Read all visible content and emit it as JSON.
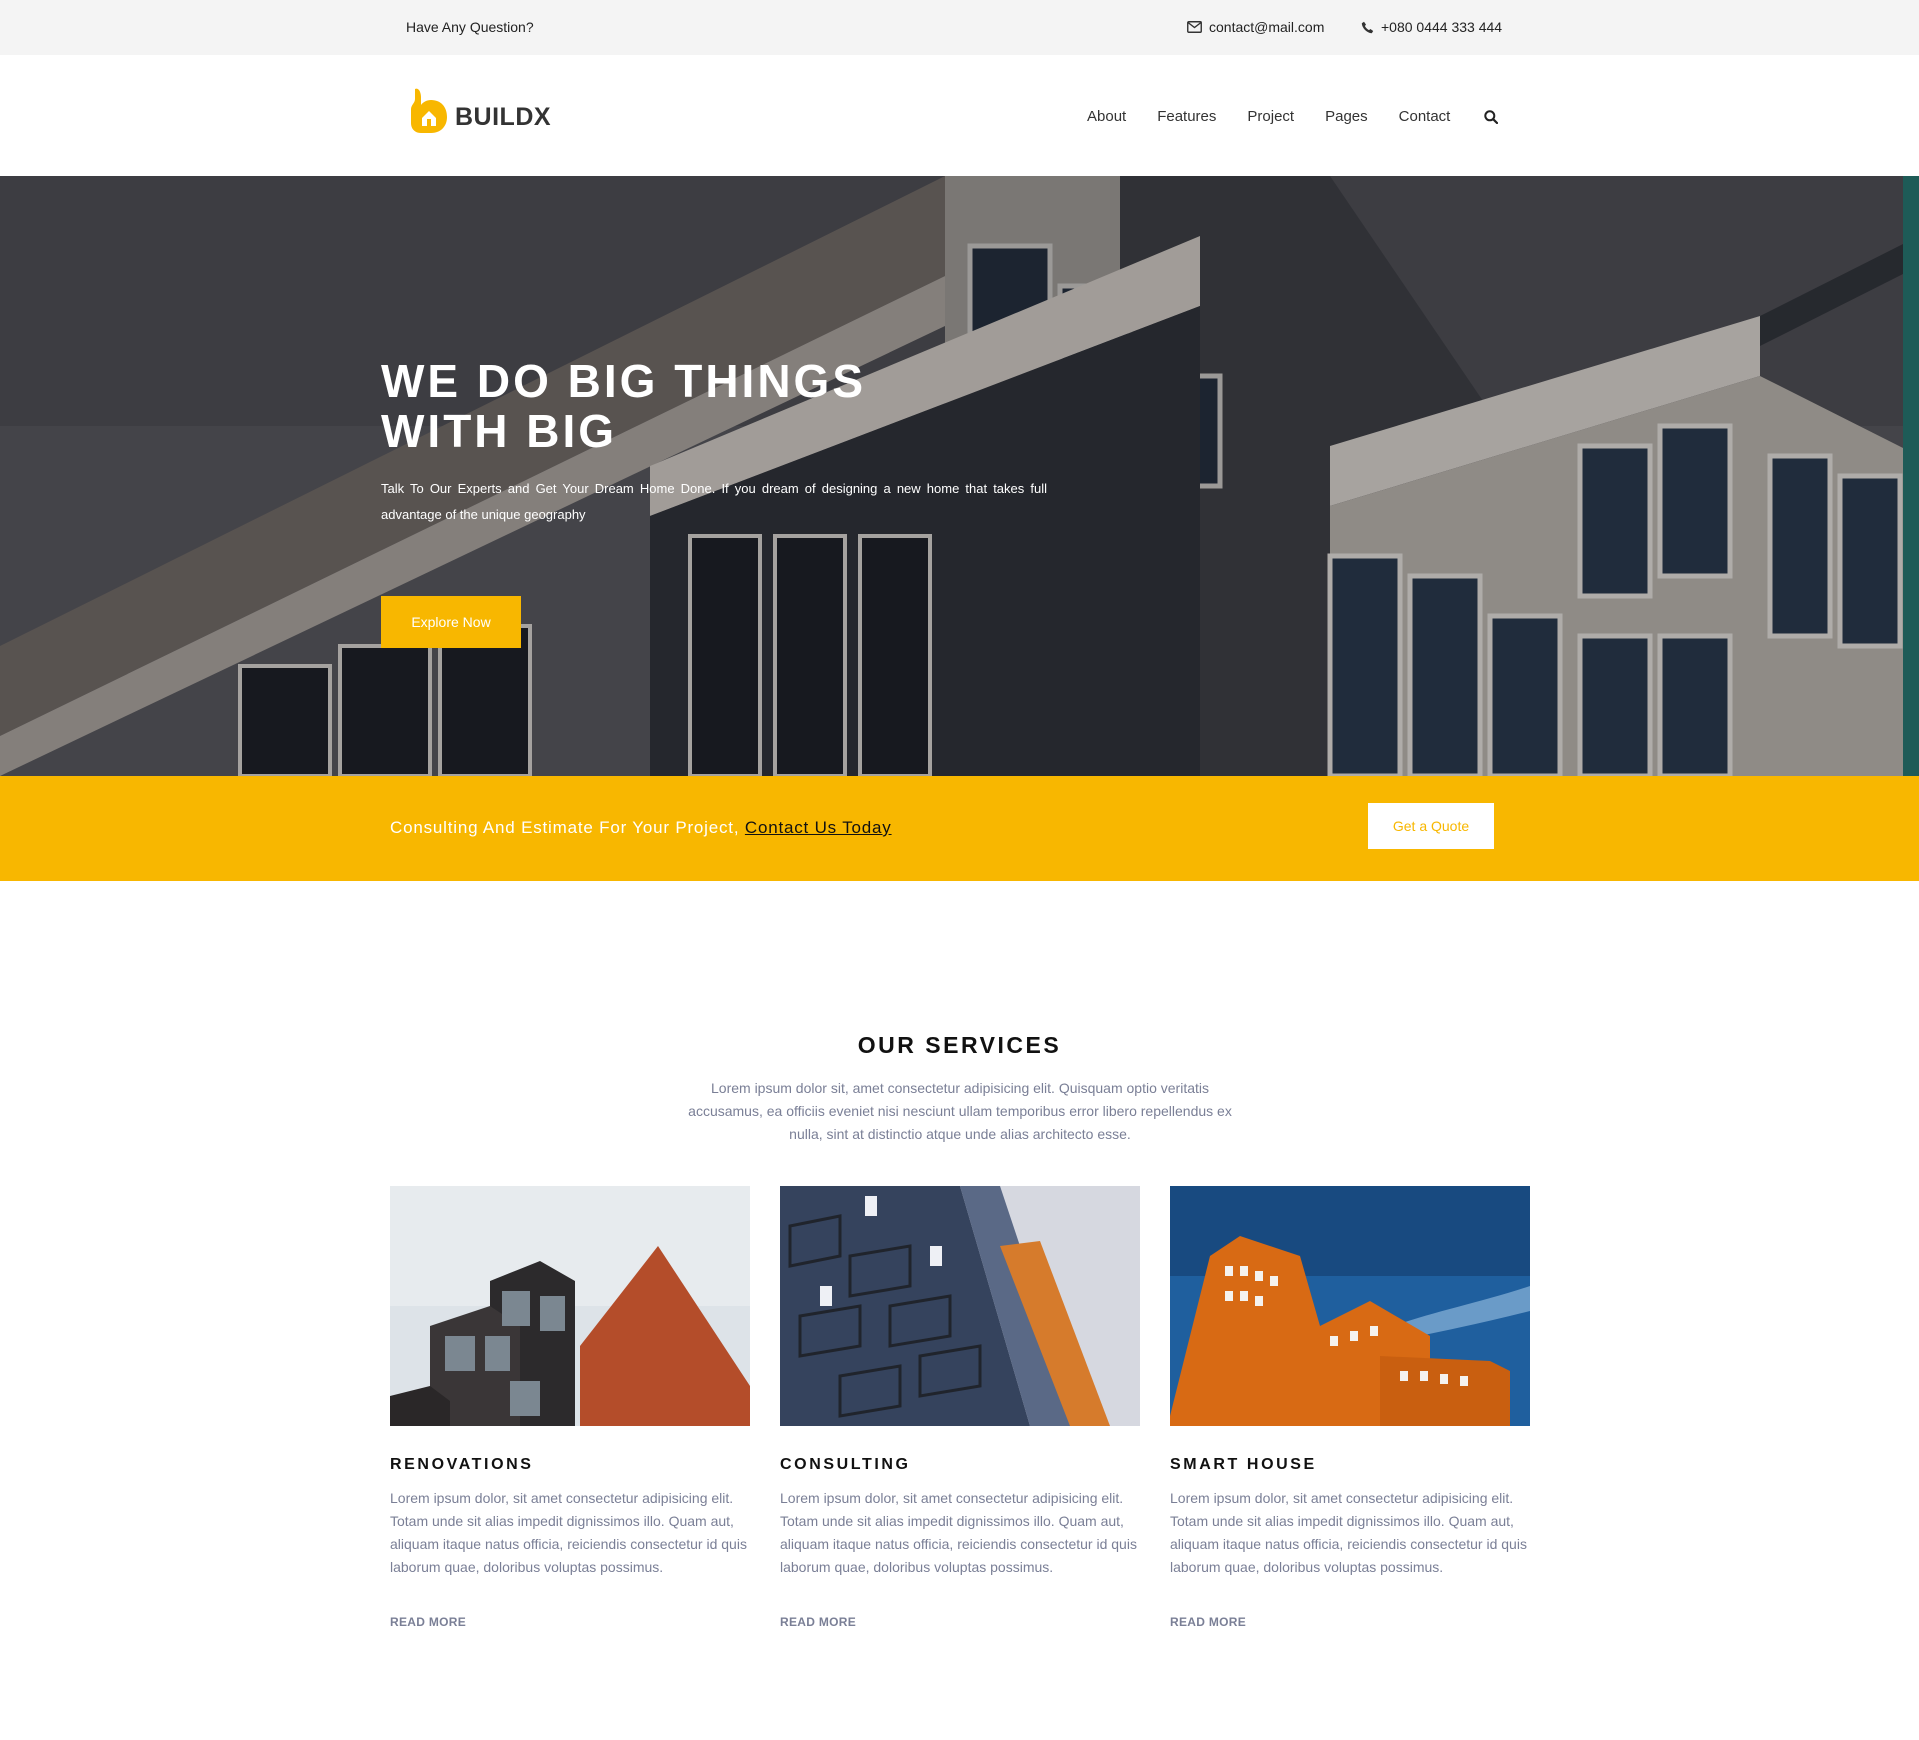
{
  "topbar": {
    "question": "Have Any Question?",
    "email": "contact@mail.com",
    "phone": "+080 0444 333 444",
    "email_icon": "envelope-icon",
    "phone_icon": "phone-icon"
  },
  "header": {
    "logo_text": "BUILDX",
    "nav": [
      "About",
      "Features",
      "Project",
      "Pages",
      "Contact"
    ],
    "search_icon": "search-icon"
  },
  "hero": {
    "title_line1": "WE DO BIG THINGS",
    "title_line2": "WITH BIG",
    "text": "Talk To Our Experts and Get Your Dream Home Done. If you dream of designing a new home that takes full advantage of the unique geography",
    "button": "Explore Now"
  },
  "cta": {
    "text": "Consulting And Estimate For Your Project,",
    "link": "Contact Us Today",
    "button": "Get a Quote"
  },
  "services": {
    "title": "OUR SERVICES",
    "description": "Lorem ipsum dolor sit, amet consectetur adipisicing elit. Quisquam optio veritatis accusamus, ea officiis eveniet nisi nesciunt ullam temporibus error libero repellendus ex nulla, sint at distinctio atque unde alias architecto esse.",
    "cards": [
      {
        "title": "RENOVATIONS",
        "body": "Lorem ipsum dolor, sit amet consectetur adipisicing elit. Totam unde sit alias impedit dignissimos illo. Quam aut, aliquam itaque natus officia, reiciendis consectetur id quis laborum quae, doloribus voluptas possimus.",
        "link": "READ MORE"
      },
      {
        "title": "CONSULTING",
        "body": "Lorem ipsum dolor, sit amet consectetur adipisicing elit. Totam unde sit alias impedit dignissimos illo. Quam aut, aliquam itaque natus officia, reiciendis consectetur id quis laborum quae, doloribus voluptas possimus.",
        "link": "READ MORE"
      },
      {
        "title": "SMART HOUSE",
        "body": "Lorem ipsum dolor, sit amet consectetur adipisicing elit. Totam unde sit alias impedit dignissimos illo. Quam aut, aliquam itaque natus officia, reiciendis consectetur id quis laborum quae, doloribus voluptas possimus.",
        "link": "READ MORE"
      }
    ]
  },
  "colors": {
    "accent": "#f8b700",
    "text_muted": "#7a7f96",
    "strip": "#1e5b57"
  }
}
